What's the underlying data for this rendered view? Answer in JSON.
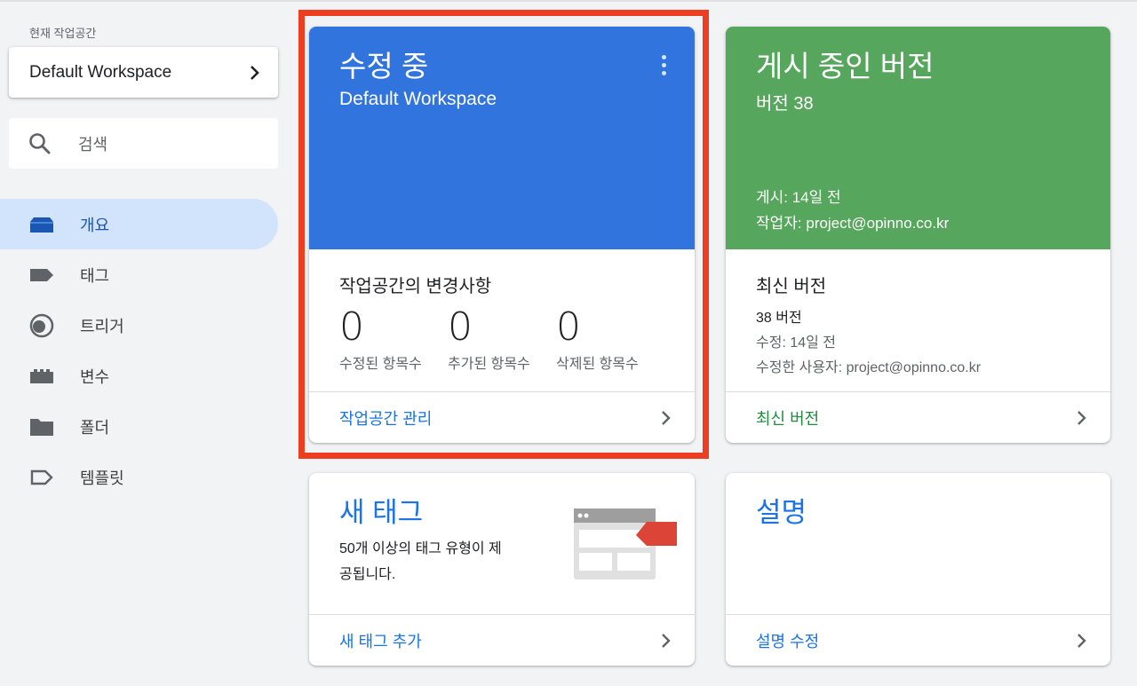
{
  "sidebar": {
    "workspace_label": "현재 작업공간",
    "workspace_name": "Default Workspace",
    "search_placeholder": "검색",
    "items": [
      {
        "label": "개요",
        "icon": "overview-icon"
      },
      {
        "label": "태그",
        "icon": "tag-icon"
      },
      {
        "label": "트리거",
        "icon": "trigger-icon"
      },
      {
        "label": "변수",
        "icon": "variable-icon"
      },
      {
        "label": "폴더",
        "icon": "folder-icon"
      },
      {
        "label": "템플릿",
        "icon": "template-icon"
      }
    ]
  },
  "editing_card": {
    "title": "수정 중",
    "subtitle": "Default Workspace",
    "section_title": "작업공간의 변경사항",
    "stats": [
      {
        "value": "0",
        "label": "수정된 항목수"
      },
      {
        "value": "0",
        "label": "추가된 항목수"
      },
      {
        "value": "0",
        "label": "삭제된 항목수"
      }
    ],
    "footer_label": "작업공간 관리",
    "color": "#3174de"
  },
  "published_card": {
    "title": "게시 중인 버전",
    "version": "버전 38",
    "published": "게시: 14일 전",
    "author": "작업자: project@opinno.co.kr",
    "section_title": "최신 버전",
    "latest_version": "38 버전",
    "modified": "수정: 14일 전",
    "modified_by": "수정한 사용자: project@opinno.co.kr",
    "footer_label": "최신 버전",
    "color": "#57a65d"
  },
  "new_tag_card": {
    "title": "새 태그",
    "description_line1": "50개 이상의 태그 유형이 제",
    "description_line2": "공됩니다.",
    "footer_label": "새 태그 추가"
  },
  "description_card": {
    "title": "설명",
    "footer_label": "설명 수정"
  },
  "colors": {
    "link_blue": "#1a73e8",
    "link_green": "#1e8e3e",
    "highlight_frame": "#ee3e22",
    "active_nav": "#d2e3fc"
  }
}
